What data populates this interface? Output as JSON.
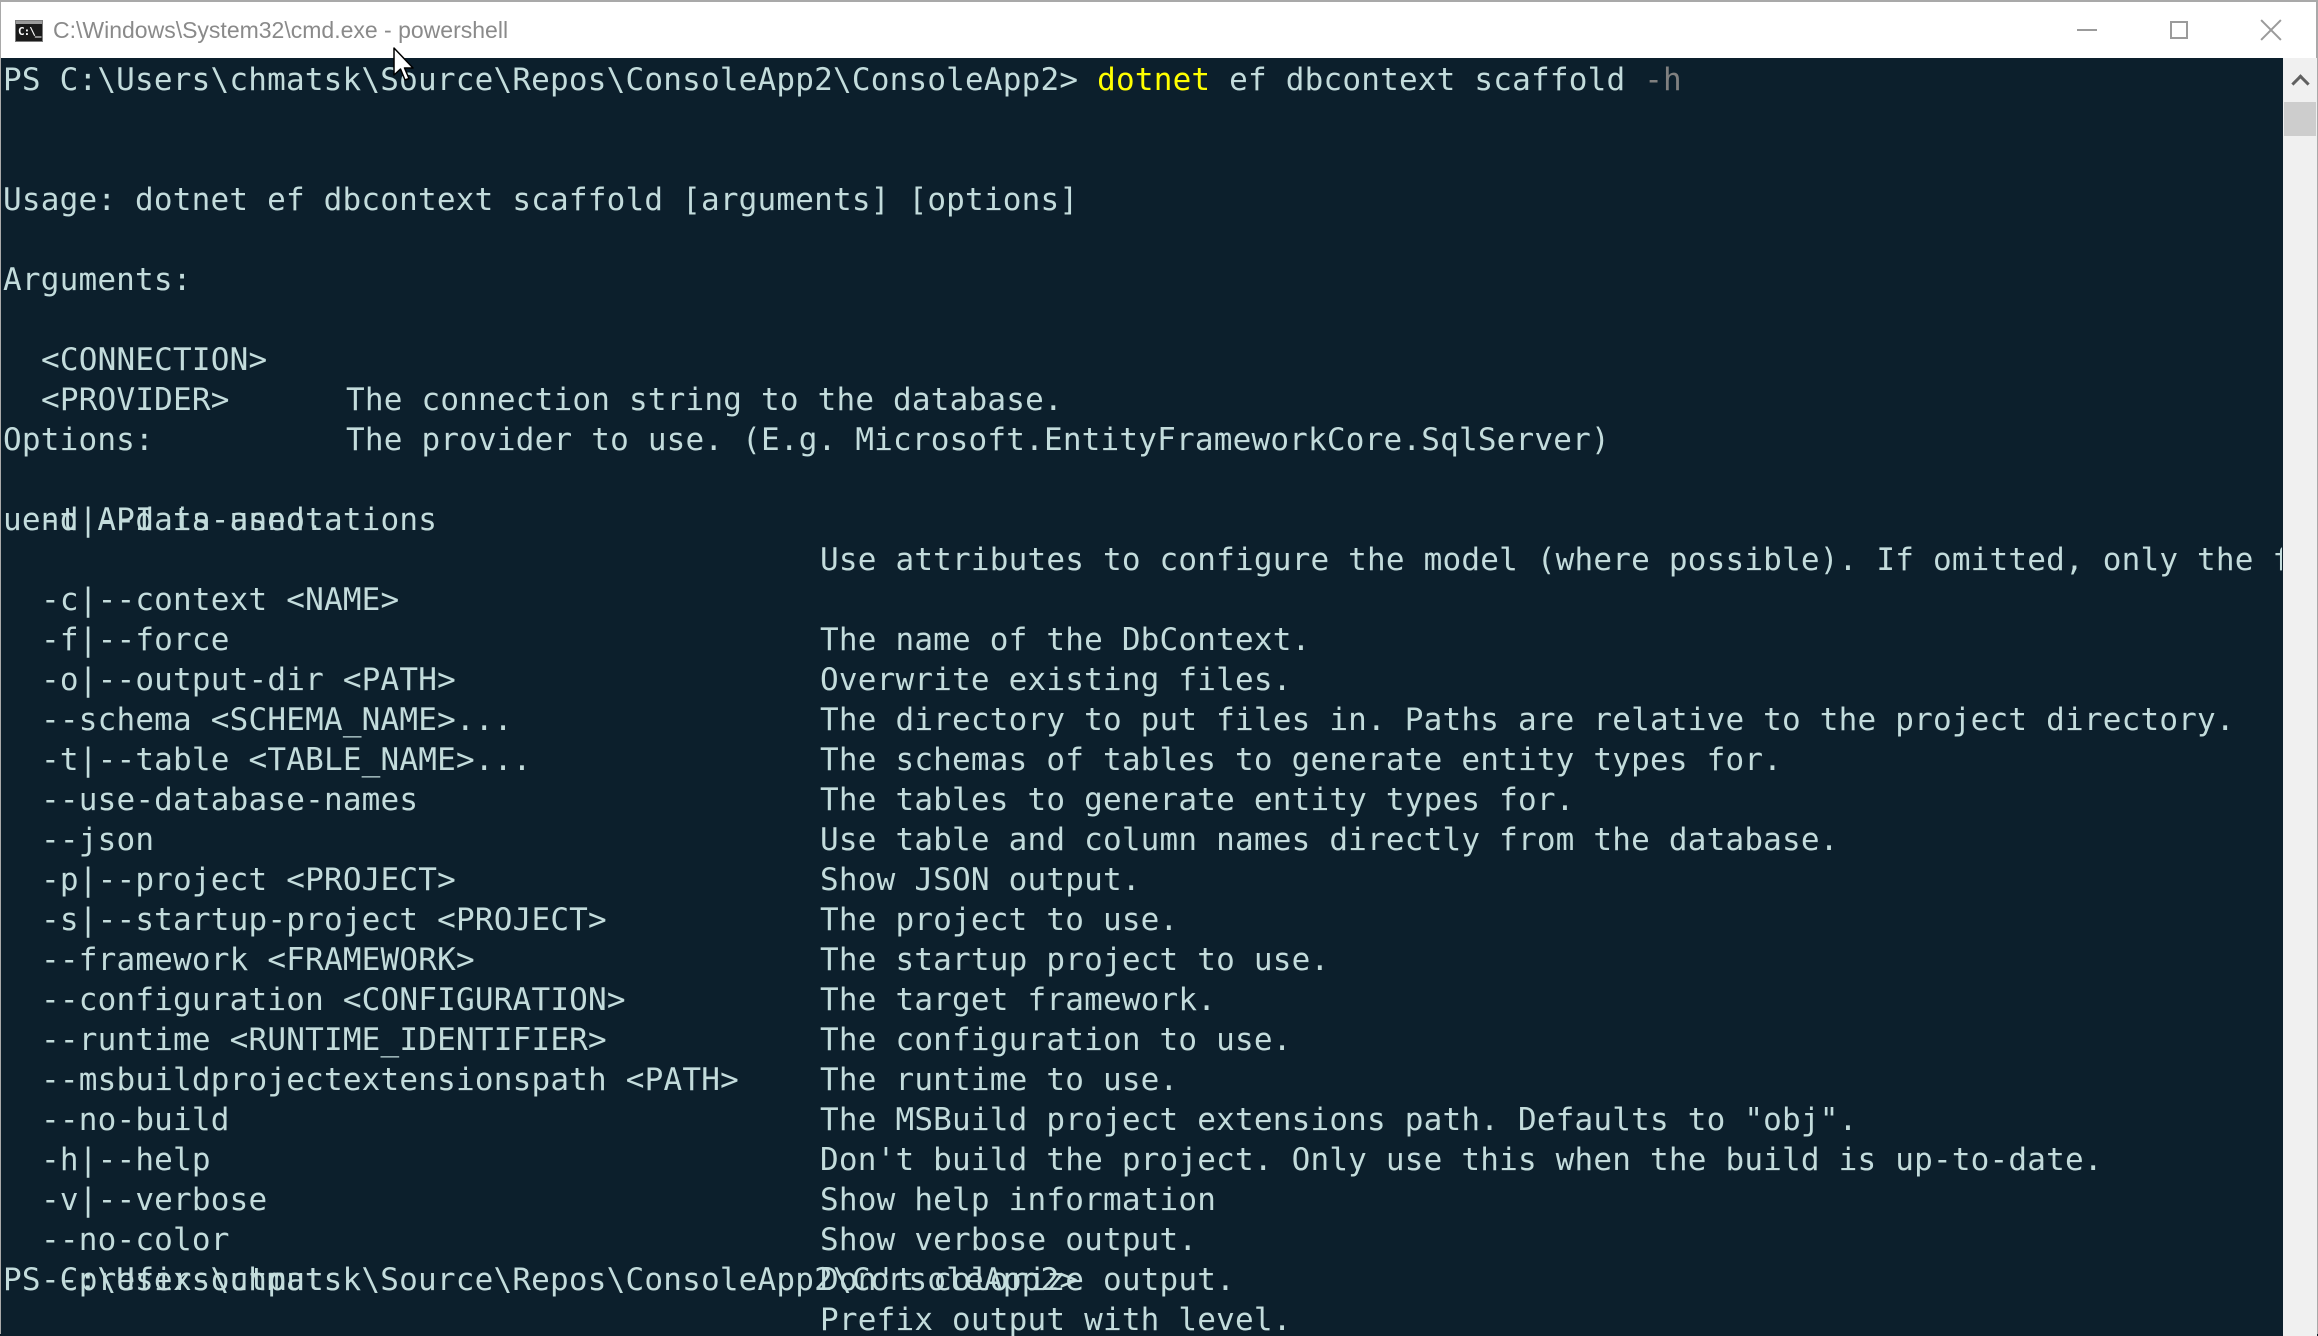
{
  "window": {
    "title": "C:\\Windows\\System32\\cmd.exe - powershell",
    "icon": "cmd-icon",
    "icon_glyph": "C:\\_",
    "controls": [
      "minimize",
      "maximize",
      "close"
    ]
  },
  "colors": {
    "background": "#0c1f2c",
    "text": "#c3dcdc",
    "command_highlight": "#ffff00",
    "parameter_gray": "#808080"
  },
  "console": {
    "prompt": "PS C:\\Users\\chmatsk\\Source\\Repos\\ConsoleApp2\\ConsoleApp2>",
    "command": {
      "executable": "dotnet",
      "args": "ef dbcontext scaffold",
      "flag": "-h"
    },
    "usage": "Usage: dotnet ef dbcontext scaffold [arguments] [options]",
    "arguments_header": "Arguments:",
    "arguments": [
      {
        "name": "<CONNECTION>",
        "description": "The connection string to the database."
      },
      {
        "name": "<PROVIDER>",
        "description": "The provider to use. (E.g. Microsoft.EntityFrameworkCore.SqlServer)"
      }
    ],
    "options_header": "Options:",
    "options": [
      {
        "flag": "-d|--data-annotations",
        "description": "Use attributes to configure the model (where possible). If omitted, only the fl"
      },
      {
        "flag": "",
        "wrap": "uent API is used."
      },
      {
        "flag": "-c|--context <NAME>",
        "description": "The name of the DbContext."
      },
      {
        "flag": "-f|--force",
        "description": "Overwrite existing files."
      },
      {
        "flag": "-o|--output-dir <PATH>",
        "description": "The directory to put files in. Paths are relative to the project directory."
      },
      {
        "flag": "--schema <SCHEMA_NAME>...",
        "description": "The schemas of tables to generate entity types for."
      },
      {
        "flag": "-t|--table <TABLE_NAME>...",
        "description": "The tables to generate entity types for."
      },
      {
        "flag": "--use-database-names",
        "description": "Use table and column names directly from the database."
      },
      {
        "flag": "--json",
        "description": "Show JSON output."
      },
      {
        "flag": "-p|--project <PROJECT>",
        "description": "The project to use."
      },
      {
        "flag": "-s|--startup-project <PROJECT>",
        "description": "The startup project to use."
      },
      {
        "flag": "--framework <FRAMEWORK>",
        "description": "The target framework."
      },
      {
        "flag": "--configuration <CONFIGURATION>",
        "description": "The configuration to use."
      },
      {
        "flag": "--runtime <RUNTIME_IDENTIFIER>",
        "description": "The runtime to use."
      },
      {
        "flag": "--msbuildprojectextensionspath <PATH>",
        "description": "The MSBuild project extensions path. Defaults to \"obj\"."
      },
      {
        "flag": "--no-build",
        "description": "Don't build the project. Only use this when the build is up-to-date."
      },
      {
        "flag": "-h|--help",
        "description": "Show help information"
      },
      {
        "flag": "-v|--verbose",
        "description": "Show verbose output."
      },
      {
        "flag": "--no-color",
        "description": "Don't colorize output."
      },
      {
        "flag": "--prefix-output",
        "description": "Prefix output with level."
      }
    ],
    "final_prompt": "PS C:\\Users\\chmatsk\\Source\\Repos\\ConsoleApp2\\ConsoleApp2>"
  }
}
